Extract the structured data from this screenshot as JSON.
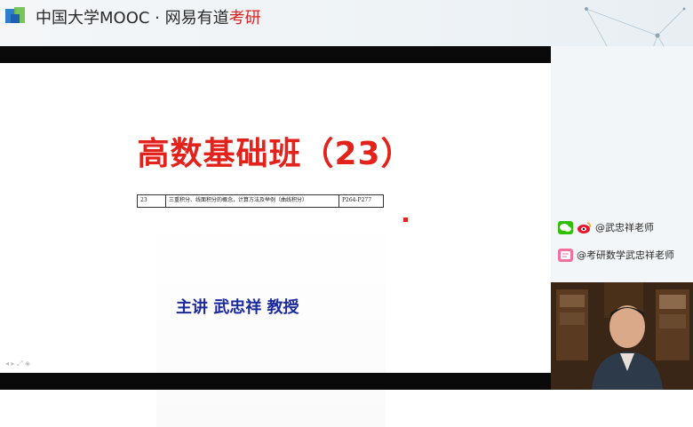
{
  "header": {
    "brand_cn": "中国大学MOOC",
    "separator": "·",
    "partner": "网易有道",
    "partner_red": "考研"
  },
  "slide": {
    "title": "高数基础班（23）",
    "table_row": {
      "no": "23",
      "topic": "三重积分、线面积分的概念，计算方法及举例（曲线积分）",
      "pages": "P264-P277"
    },
    "lecturer": "主讲  武忠祥 教授"
  },
  "social": {
    "wechat_weibo_label": "@武忠祥老师",
    "app_label": "@考研数学武忠祥老师"
  },
  "player_controls": "◂ ▸ ⤢ ◈",
  "colors": {
    "title_red": "#e3221c",
    "lecturer_blue": "#1c2a9e",
    "brand_red": "#e02020"
  }
}
